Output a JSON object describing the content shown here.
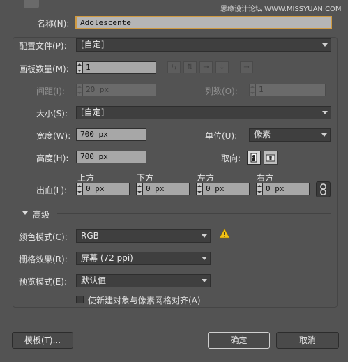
{
  "watermark": "思缘设计论坛 WWW.MISSYUAN.COM",
  "name": {
    "label": "名称(N):",
    "value": "Adolescente"
  },
  "profile": {
    "label": "配置文件(P):",
    "value": "[自定]"
  },
  "artboards": {
    "label": "画板数量(M):",
    "value": "1",
    "spacing_label": "间距(I):",
    "spacing_value": "20 px",
    "columns_label": "列数(O):",
    "columns_value": "1"
  },
  "size": {
    "label": "大小(S):",
    "value": "[自定]"
  },
  "width": {
    "label": "宽度(W):",
    "value": "700 px"
  },
  "units": {
    "label": "单位(U):",
    "value": "像素"
  },
  "height": {
    "label": "高度(H):",
    "value": "700 px"
  },
  "orientation": {
    "label": "取向:"
  },
  "bleed": {
    "label": "出血(L):",
    "top_label": "上方",
    "top_value": "0 px",
    "bottom_label": "下方",
    "bottom_value": "0 px",
    "left_label": "左方",
    "left_value": "0 px",
    "right_label": "右方",
    "right_value": "0 px"
  },
  "advanced": {
    "label": "高级",
    "color_mode_label": "颜色模式(C):",
    "color_mode_value": "RGB",
    "raster_label": "栅格效果(R):",
    "raster_value": "屏幕 (72 ppi)",
    "preview_label": "预览模式(E):",
    "preview_value": "默认值",
    "align_label": "使新建对象与像素网格对齐(A)"
  },
  "buttons": {
    "templates": "模板(T)...",
    "ok": "确定",
    "cancel": "取消"
  },
  "colors": {
    "warning": "#f3c316",
    "field_bg": "#a7a7a7",
    "panel_bg": "#535353"
  }
}
